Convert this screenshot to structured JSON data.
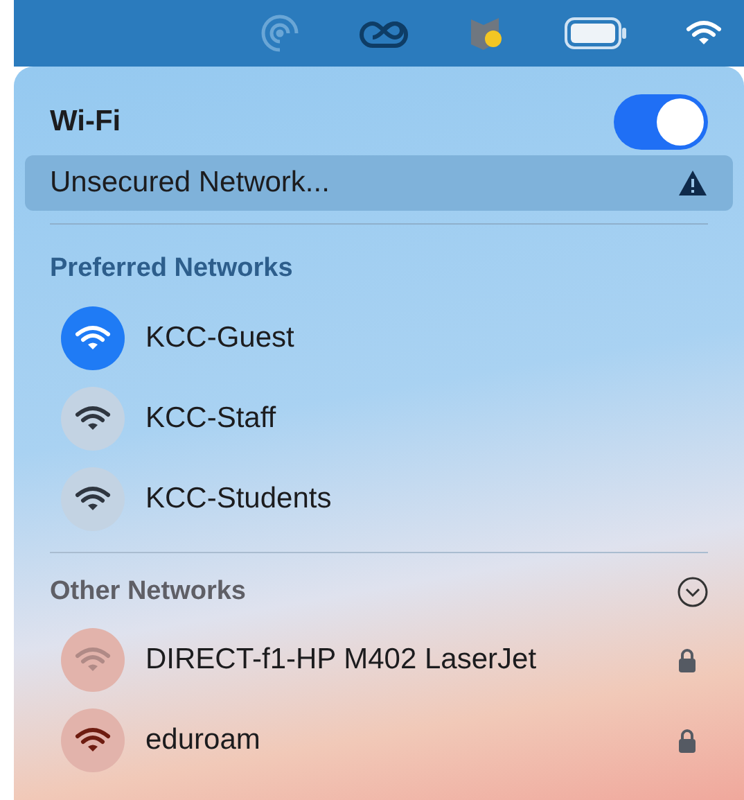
{
  "wifi": {
    "title": "Wi-Fi",
    "on": true
  },
  "current": {
    "name": "Unsecured Network...",
    "warning": true
  },
  "preferred": {
    "title": "Preferred Networks",
    "networks": [
      {
        "name": "KCC-Guest",
        "selected": true,
        "locked": false
      },
      {
        "name": "KCC-Staff",
        "selected": false,
        "locked": false
      },
      {
        "name": "KCC-Students",
        "selected": false,
        "locked": false
      }
    ]
  },
  "other": {
    "title": "Other Networks",
    "expanded": true,
    "networks": [
      {
        "name": "DIRECT-f1-HP M402 LaserJet",
        "selected": false,
        "locked": true,
        "dim": true
      },
      {
        "name": "eduroam",
        "selected": false,
        "locked": true,
        "dim": false
      }
    ]
  }
}
